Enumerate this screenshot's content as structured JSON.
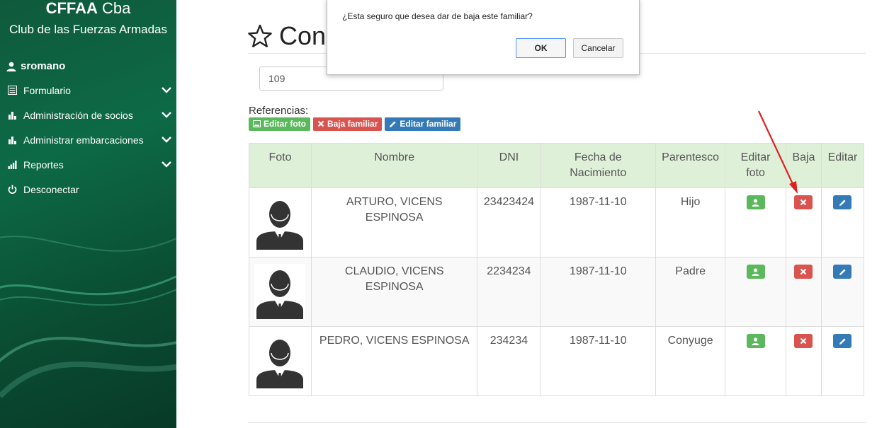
{
  "sidebar": {
    "brand_main": "CFFAA",
    "brand_suffix": "Cba",
    "brand_sub": "Club de las Fuerzas Armadas",
    "user": "sromano",
    "items": [
      {
        "label": "Formulario",
        "icon": "list-icon"
      },
      {
        "label": "Administración de socios",
        "icon": "bar-chart-icon"
      },
      {
        "label": "Administrar embarcaciones",
        "icon": "bar-chart-icon"
      },
      {
        "label": "Reportes",
        "icon": "signal-icon"
      },
      {
        "label": "Desconectar",
        "icon": "power-icon"
      }
    ]
  },
  "main": {
    "title": "Con",
    "search_value": "109",
    "refs_label": "Referencias:",
    "refs": {
      "edit_photo": "Editar foto",
      "remove_family": "Baja familiar",
      "edit_family": "Editar familiar"
    },
    "table": {
      "headers": {
        "foto": "Foto",
        "nombre": "Nombre",
        "dni": "DNI",
        "fecha_1": "Fecha de",
        "fecha_2": "Nacimiento",
        "parentesco": "Parentesco",
        "editar_foto_1": "Editar",
        "editar_foto_2": "foto",
        "baja": "Baja",
        "editar": "Editar"
      },
      "rows": [
        {
          "nombre": "ARTURO, VICENS ESPINOSA",
          "dni": "23423424",
          "fecha": "1987-11-10",
          "parentesco": "Hijo"
        },
        {
          "nombre": "CLAUDIO, VICENS ESPINOSA",
          "dni": "2234234",
          "fecha": "1987-11-10",
          "parentesco": "Padre"
        },
        {
          "nombre": "PEDRO, VICENS ESPINOSA",
          "dni": "234234",
          "fecha": "1987-11-10",
          "parentesco": "Conyuge"
        }
      ]
    }
  },
  "dialog": {
    "message": "¿Esta seguro que desea dar de baja este familiar?",
    "ok": "OK",
    "cancel": "Cancelar"
  },
  "colors": {
    "sidebar": "#0d6a46",
    "success": "#5cb85c",
    "danger": "#d9534f",
    "primary": "#337ab7",
    "header_bg": "#dff0d8"
  }
}
